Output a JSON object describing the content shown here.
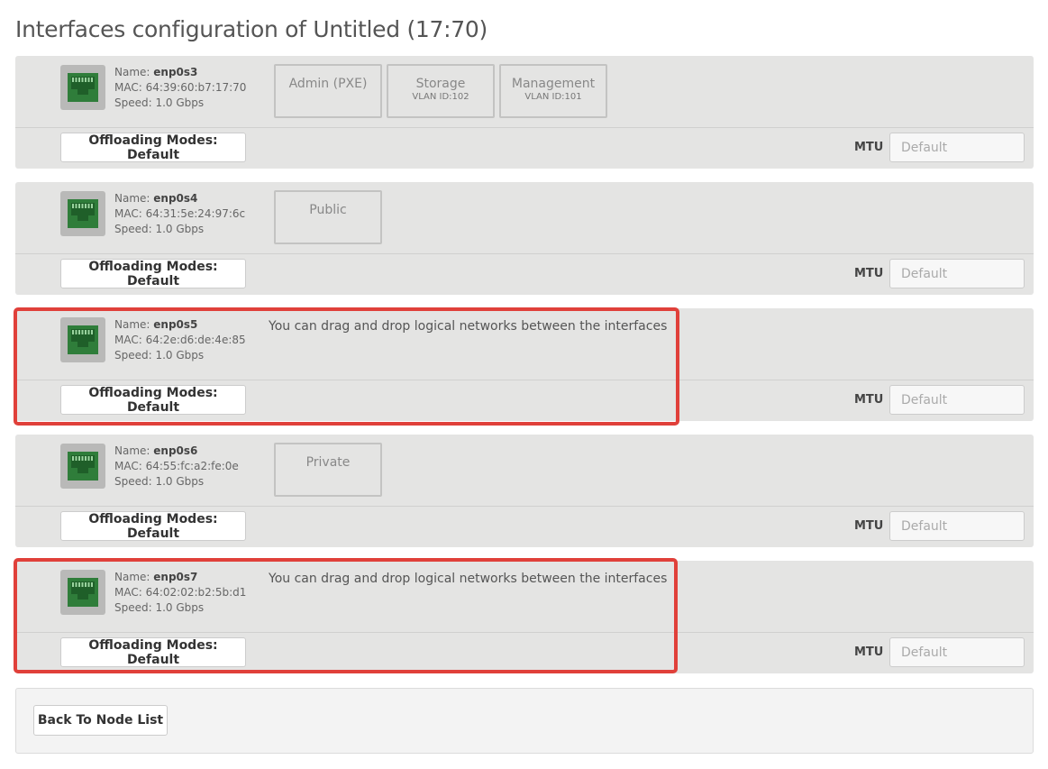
{
  "page_title": "Interfaces configuration of Untitled (17:70)",
  "labels": {
    "name": "Name: ",
    "mac": "MAC: ",
    "speed": "Speed: ",
    "offloading": "Offloading Modes: Default",
    "mtu": "MTU",
    "mtu_placeholder": "Default",
    "hint": "You can drag and drop logical networks between the interfaces"
  },
  "interfaces": [
    {
      "name": "enp0s3",
      "mac": "64:39:60:b7:17:70",
      "speed": "1.0 Gbps",
      "networks": [
        {
          "name": "Admin (PXE)",
          "vlan": ""
        },
        {
          "name": "Storage",
          "vlan": "VLAN ID:102"
        },
        {
          "name": "Management",
          "vlan": "VLAN ID:101"
        }
      ]
    },
    {
      "name": "enp0s4",
      "mac": "64:31:5e:24:97:6c",
      "speed": "1.0 Gbps",
      "networks": [
        {
          "name": "Public",
          "vlan": ""
        }
      ]
    },
    {
      "name": "enp0s5",
      "mac": "64:2e:d6:de:4e:85",
      "speed": "1.0 Gbps",
      "networks": [],
      "highlighted": true
    },
    {
      "name": "enp0s6",
      "mac": "64:55:fc:a2:fe:0e",
      "speed": "1.0 Gbps",
      "networks": [
        {
          "name": "Private",
          "vlan": ""
        }
      ]
    },
    {
      "name": "enp0s7",
      "mac": "64:02:02:b2:5b:d1",
      "speed": "1.0 Gbps",
      "networks": [],
      "highlighted": true
    }
  ],
  "footer": {
    "back_label": "Back To Node List"
  },
  "colors": {
    "nic_icon": "#2f7d3a",
    "highlight": "#e0403a",
    "panel": "#e4e4e3"
  },
  "icons": {
    "nic": "ethernet-port-icon"
  }
}
